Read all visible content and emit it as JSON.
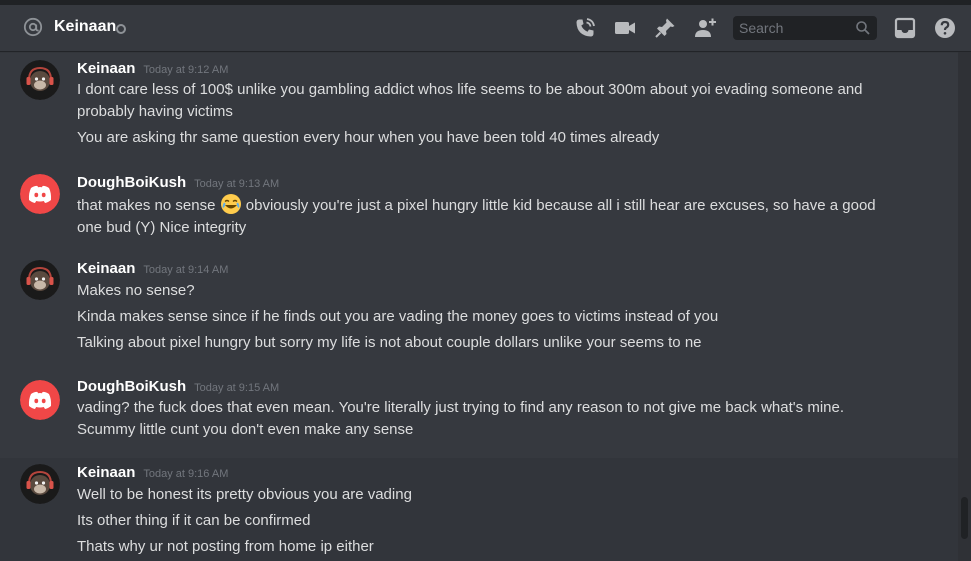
{
  "header": {
    "channel_name": "Keinaan",
    "search_placeholder": "Search",
    "icons": [
      "at-icon",
      "call-icon",
      "video-icon",
      "pin-icon",
      "add-friend-icon",
      "search-icon",
      "inbox-icon",
      "help-icon"
    ]
  },
  "colors": {
    "background": "#36393f",
    "header_strip": "#202225",
    "username": "#ffffff",
    "text": "#dcddde",
    "timestamp": "#72767d",
    "discord_red_avatar": "#f04747"
  },
  "messages": [
    {
      "author": "Keinaan",
      "timestamp": "Today at 9:12 AM",
      "avatar": "monkey-headphones-avatar",
      "lines": [
        "I dont care less of 100$ unlike you gambling addict whos life seems to be about 300m about yoi evading someone and probably having victims",
        "You are asking thr same question every hour when you have been told 40 times already"
      ]
    },
    {
      "author": "DoughBoiKush",
      "timestamp": "Today at 9:13 AM",
      "avatar": "discord-default-avatar",
      "lines": [
        {
          "before": "that makes no sense",
          "emoji": "joy-emoji",
          "after": "obviously you're just a pixel hungry little kid because all i still hear are excuses, so have a good one bud (Y) Nice integrity"
        }
      ]
    },
    {
      "author": "Keinaan",
      "timestamp": "Today at 9:14 AM",
      "avatar": "monkey-headphones-avatar",
      "lines": [
        "Makes no sense?",
        "Kinda makes sense since if he finds out you are vading the money goes to victims instead of you",
        "Talking about pixel hungry but sorry my life is not about couple dollars unlike your seems to ne"
      ]
    },
    {
      "author": "DoughBoiKush",
      "timestamp": "Today at 9:15 AM",
      "avatar": "discord-default-avatar",
      "lines": [
        "vading? the fuck does that even mean. You're literally just trying to find any reason to not give me back what's mine. Scummy little cunt you don't even make any sense"
      ]
    },
    {
      "author": "Keinaan",
      "timestamp": "Today at 9:16 AM",
      "avatar": "monkey-headphones-avatar",
      "lines": [
        "Well to be honest its pretty obvious you are vading",
        "Its other thing if it can be confirmed",
        "Thats why ur not posting from home ip either"
      ]
    }
  ]
}
